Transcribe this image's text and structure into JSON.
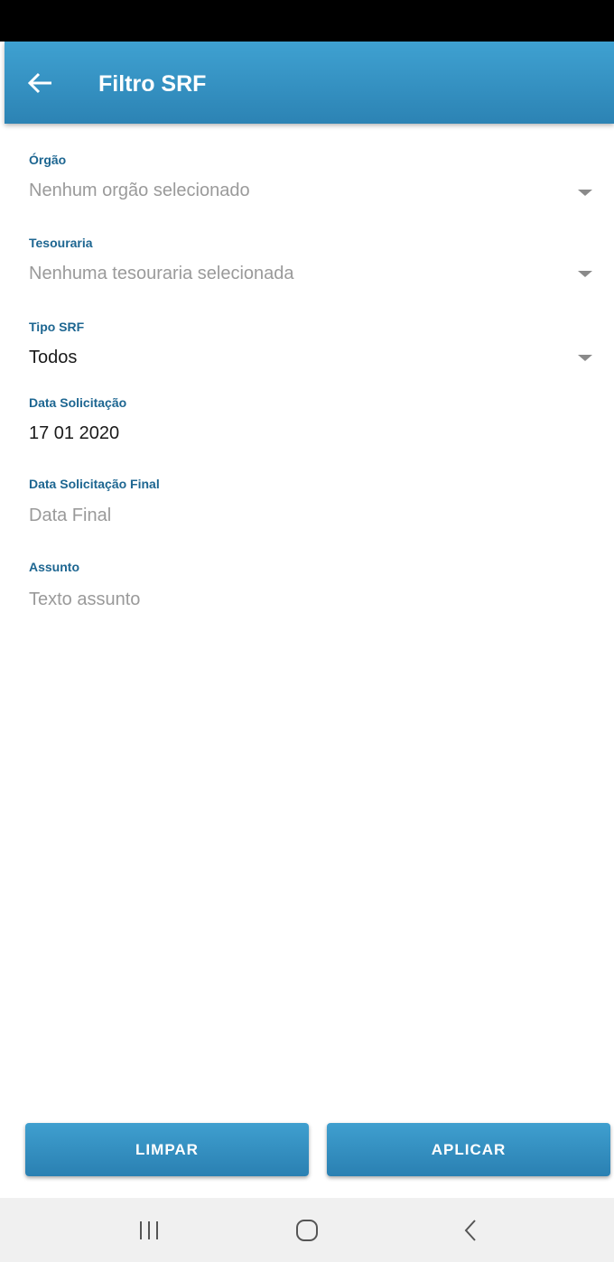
{
  "app_bar": {
    "title": "Filtro SRF",
    "back_icon": "arrow-left-icon"
  },
  "fields": {
    "orgao": {
      "label": "Órgão",
      "value": "Nenhum orgão selecionado",
      "is_placeholder": true,
      "icon": "dropdown-arrow-icon"
    },
    "tesouraria": {
      "label": "Tesouraria",
      "value": "Nenhuma tesouraria selecionada",
      "is_placeholder": true,
      "icon": "dropdown-arrow-icon"
    },
    "tipo_srf": {
      "label": "Tipo SRF",
      "value": "Todos",
      "is_placeholder": false,
      "icon": "dropdown-arrow-icon"
    },
    "data_solicitacao": {
      "label": "Data Solicitação",
      "value": "17 01 2020"
    },
    "data_solicitacao_final": {
      "label": "Data Solicitação Final",
      "placeholder": "Data Final"
    },
    "assunto": {
      "label": "Assunto",
      "placeholder": "Texto assunto"
    }
  },
  "actions": {
    "clear_label": "LIMPAR",
    "apply_label": "APLICAR"
  },
  "nav_bar": {
    "recents_icon": "recent-apps-icon",
    "home_icon": "home-icon",
    "back_icon": "back-chevron-icon"
  },
  "colors": {
    "primary": "#3399cc",
    "label": "#1d6691",
    "placeholder": "#9a9a9a",
    "text": "#1a1a1a"
  }
}
